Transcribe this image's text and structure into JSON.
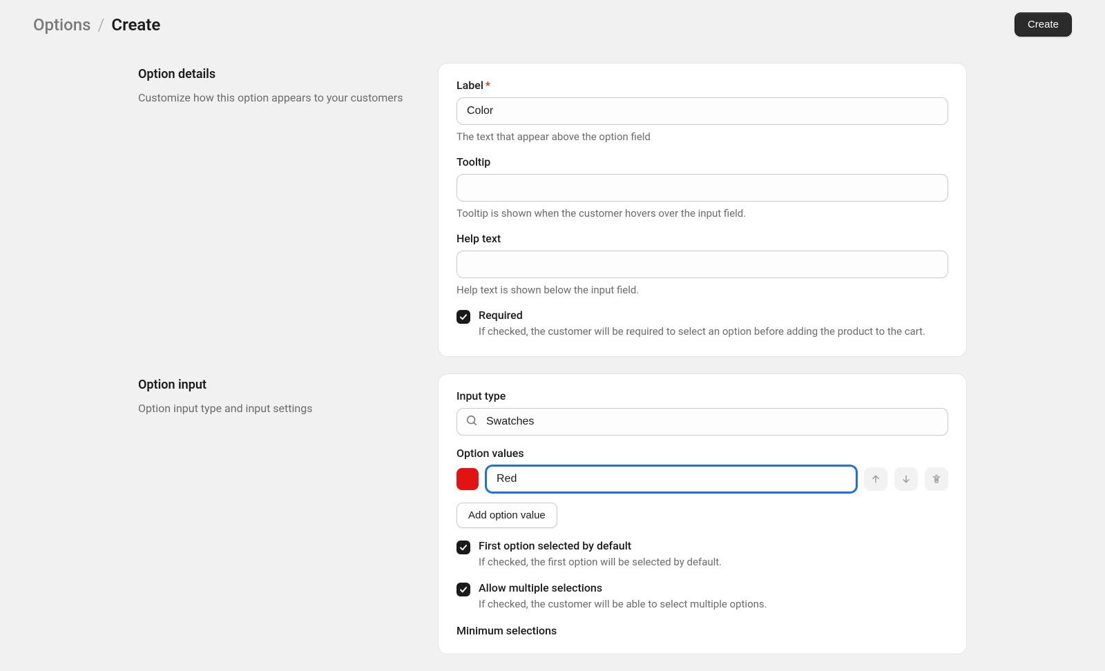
{
  "header": {
    "breadcrumb_parent": "Options",
    "breadcrumb_sep": "/",
    "breadcrumb_current": "Create",
    "create_button": "Create"
  },
  "details": {
    "title": "Option details",
    "desc": "Customize how this option appears to your customers",
    "label_field": {
      "label": "Label",
      "required_marker": "*",
      "value": "Color",
      "help": "The text that appear above the option field"
    },
    "tooltip_field": {
      "label": "Tooltip",
      "value": "",
      "help": "Tooltip is shown when the customer hovers over the input field."
    },
    "helptext_field": {
      "label": "Help text",
      "value": "",
      "help": "Help text is shown below the input field."
    },
    "required_checkbox": {
      "label": "Required",
      "desc": "If checked, the customer will be required to select an option before adding the product to the cart."
    }
  },
  "input": {
    "title": "Option input",
    "desc": "Option input type and input settings",
    "input_type": {
      "label": "Input type",
      "value": "Swatches"
    },
    "option_values": {
      "label": "Option values",
      "items": [
        {
          "color": "#e21313",
          "name": "Red"
        }
      ],
      "add_button": "Add option value"
    },
    "first_selected": {
      "label": "First option selected by default",
      "desc": "If checked, the first option will be selected by default."
    },
    "allow_multiple": {
      "label": "Allow multiple selections",
      "desc": "If checked, the customer will be able to select multiple options."
    },
    "min_selections_label": "Minimum selections"
  }
}
